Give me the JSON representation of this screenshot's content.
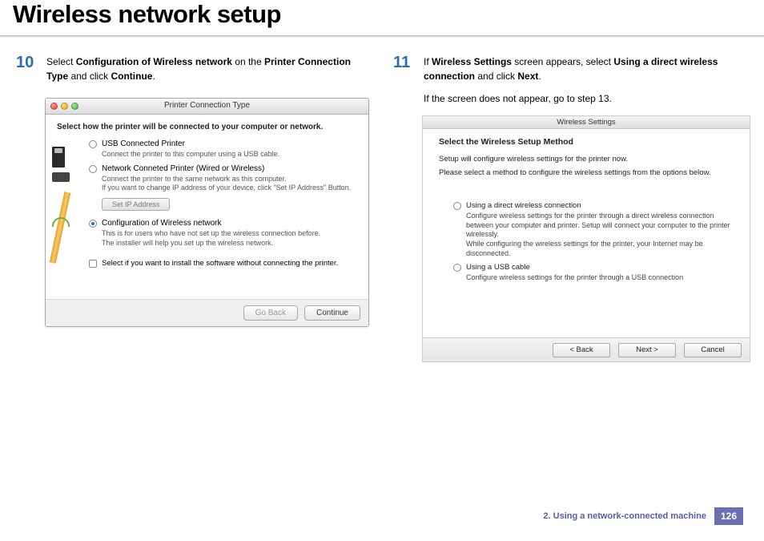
{
  "page": {
    "title": "Wireless network setup",
    "chapter": "2.  Using a network-connected machine",
    "number": "126"
  },
  "step10": {
    "num": "10",
    "text_parts": [
      "Select ",
      "Configuration of Wireless network",
      " on the ",
      "Printer Connection Type",
      " and click ",
      "Continue",
      "."
    ]
  },
  "step11": {
    "num": "11",
    "text_parts": [
      "If ",
      "Wireless Settings",
      " screen appears, select ",
      "Using a direct wireless connection",
      " and click ",
      "Next",
      "."
    ],
    "extra": "If the screen does not appear, go to step 13."
  },
  "dialog1": {
    "title": "Printer Connection Type",
    "heading": "Select how the printer will be connected to your computer or network.",
    "opt1_label": "USB Connected Printer",
    "opt1_desc": "Connect the printer to this computer using a USB cable.",
    "opt2_label": "Network Conneted Printer (Wired or Wireless)",
    "opt2_desc": "Connect the printer to the same network as this computer.\nIf you want to change IP address of your device, click \"Set IP Address\" Button.",
    "setip": "Set IP Address",
    "opt3_label": "Configuration of Wireless network",
    "opt3_desc": "This is for users who have not set up the wireless connection before.\nThe installer will help you set up the wireless network.",
    "check_label": "Select if you want to install the software without connecting the printer.",
    "back": "Go Back",
    "continue": "Continue"
  },
  "dialog2": {
    "title": "Wireless Settings",
    "heading": "Select the Wireless Setup Method",
    "intro1": "Setup will configure wireless settings for the printer now.",
    "intro2": "Please select a method to configure the wireless settings from the options below.",
    "opt1_label": "Using a direct wireless connection",
    "opt1_desc": "Configure wireless settings for the printer through a direct wireless connection between your computer and printer. Setup will connect your computer to the printer wirelessly.\nWhile configuring the wireless settings for the printer, your Internet may be disconnected.",
    "opt2_label": "Using a USB cable",
    "opt2_desc": "Configure wireless settings for the printer through a USB connection",
    "back": "< Back",
    "next": "Next >",
    "cancel": "Cancel"
  }
}
